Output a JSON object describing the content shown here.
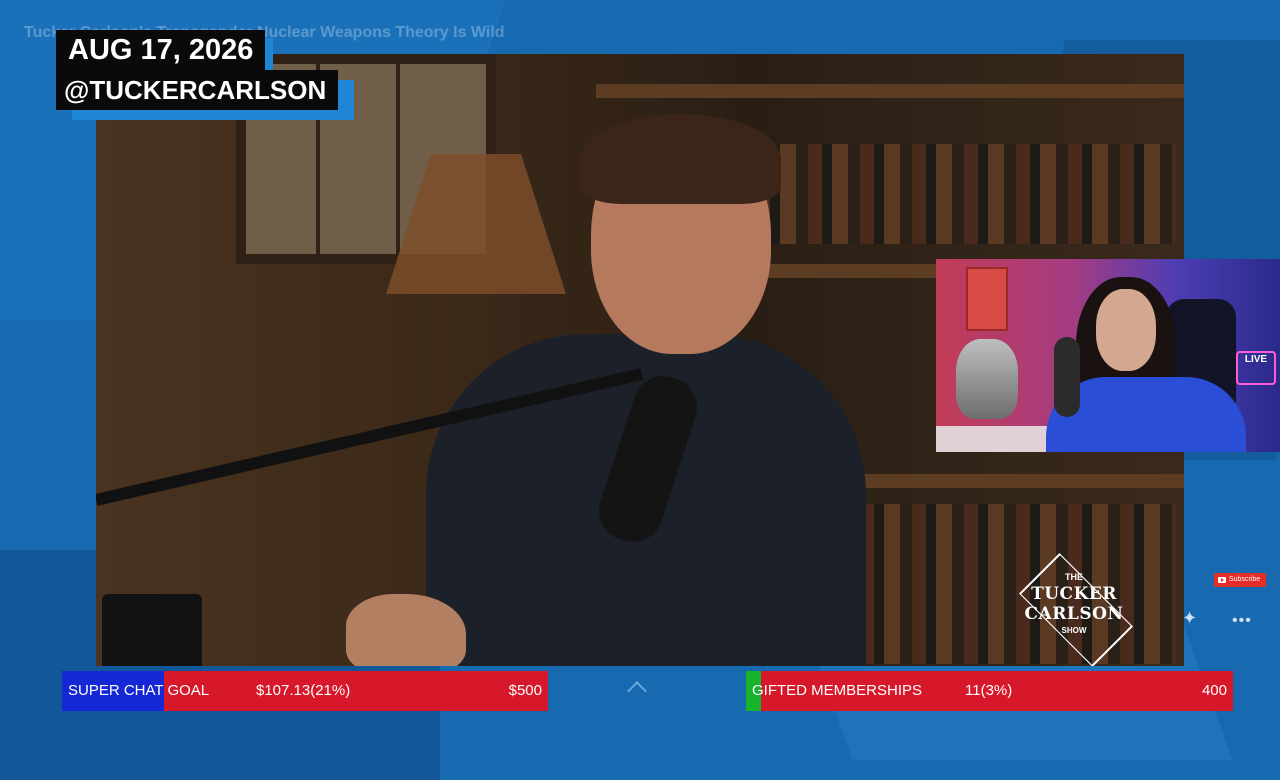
{
  "video": {
    "title": "Tucker Carlson's Transgender Nuclear Weapons Theory Is Wild",
    "date_label": "AUG 17, 2026",
    "handle_label": "@TUCKERCARLSON",
    "show_logo": {
      "line1": "THE",
      "line2": "TUCKER",
      "line3": "CARLSON",
      "line4": "SHOW"
    }
  },
  "cam": {
    "live_text": "LIVE"
  },
  "subscribe": {
    "label": "Subscribe"
  },
  "goals": {
    "super_chat": {
      "label": "SUPER CHAT GOAL",
      "current": "$107.13(21%)",
      "target": "$500",
      "progress": 0.21,
      "fill_color": "#1627d6",
      "bar_color": "#d7182a"
    },
    "memberships": {
      "label": "GIFTED MEMBERSHIPS",
      "current": "11(3%)",
      "target": "400",
      "progress": 0.03,
      "fill_color": "#17b42a",
      "bar_color": "#d7182a"
    }
  }
}
